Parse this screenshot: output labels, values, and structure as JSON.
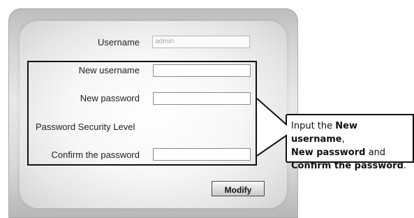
{
  "form": {
    "username_label": "Username",
    "username_value": "admin",
    "new_username_label": "New username",
    "new_password_label": "New password",
    "security_level_label": "Password Security Level",
    "confirm_password_label": "Confirm the password",
    "modify_button_label": "Modify"
  },
  "callout": {
    "prefix": "Input the ",
    "new_username": "New username",
    "comma": ",",
    "new_password": "New password",
    "and": " and",
    "confirm_password": "Confirm the password",
    "period": "."
  },
  "colors": {
    "panel_background": "#d8d8d8",
    "highlight_border": "#111111",
    "button_text": "#111111"
  }
}
